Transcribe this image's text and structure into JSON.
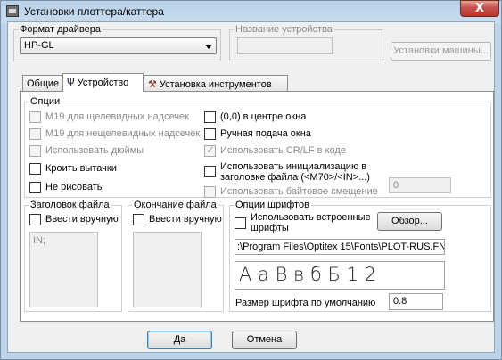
{
  "window": {
    "title": "Установки плоттера/каттера",
    "close_glyph": "X"
  },
  "driver": {
    "label": "Формат драйвера",
    "selected": "HP-GL"
  },
  "device_name": {
    "label": "Название устройства",
    "value": ""
  },
  "machine_settings_button": "Установки машины...",
  "tabs": [
    {
      "label": "Общие",
      "icon": "none"
    },
    {
      "label": "Устройство",
      "icon": "device-fork-icon"
    },
    {
      "label": "Установка инструментов",
      "icon": "hammer-icon"
    }
  ],
  "options": {
    "label": "Опции",
    "left": [
      {
        "label": "M19 для щелевидных надсечек",
        "checked": false,
        "disabled": true
      },
      {
        "label": "M19 для нещелевидных надсечек",
        "checked": false,
        "disabled": true
      },
      {
        "label": "Использовать дюймы",
        "checked": false,
        "disabled": true
      },
      {
        "label": "Кроить вытачки",
        "checked": false,
        "disabled": false
      },
      {
        "label": "Не рисовать",
        "checked": false,
        "disabled": false
      }
    ],
    "right": [
      {
        "label": "(0,0) в центре окна",
        "checked": false,
        "disabled": false
      },
      {
        "label": "Ручная подача окна",
        "checked": false,
        "disabled": false
      },
      {
        "label": "Использовать CR/LF в коде",
        "checked": true,
        "disabled": true
      },
      {
        "label_line1": "Использовать инициализацию в",
        "label_line2": "заголовке файла (<M70>/<IN>...)",
        "checked": false,
        "disabled": false
      },
      {
        "label": "Использовать байтовое смещение",
        "checked": false,
        "disabled": true
      }
    ],
    "byte_offset_value": "0"
  },
  "file_header": {
    "label": "Заголовок файла",
    "manual_label": "Ввести вручную",
    "text": "IN;"
  },
  "file_end": {
    "label": "Окончание файла",
    "manual_label": "Ввести вручную",
    "text": ""
  },
  "font_options": {
    "label": "Опции шрифтов",
    "builtin_line1": "Использовать встроенные",
    "builtin_line2": "шрифты",
    "browse_button": "Обзор...",
    "font_path": ":\\Program Files\\Optitex 15\\Fonts\\PLOT-RUS.FN",
    "preview": "А а В в б Б 1 2",
    "default_size_label": "Размер шрифта по умолчанию",
    "default_size_value": "0.8"
  },
  "buttons": {
    "ok": "Да",
    "cancel": "Отмена"
  }
}
